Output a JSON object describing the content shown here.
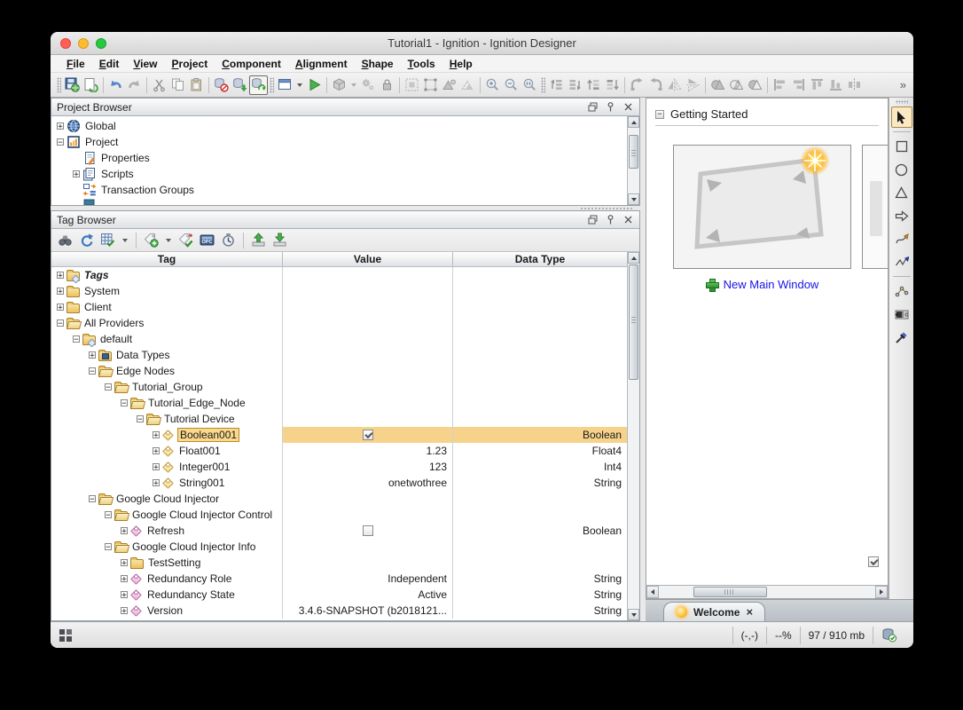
{
  "window": {
    "title": "Tutorial1 - Ignition - Ignition Designer"
  },
  "menu": {
    "items": [
      "File",
      "Edit",
      "View",
      "Project",
      "Component",
      "Alignment",
      "Shape",
      "Tools",
      "Help"
    ]
  },
  "toolbar": {
    "overflow": "»",
    "icons": [
      "save-all",
      "publish",
      "undo",
      "redo",
      "cut",
      "copy",
      "paste",
      "db-rollback",
      "db-sync",
      "db-merge",
      "new-window",
      "preview-play",
      "component-cube",
      "gears",
      "lock",
      "selection-bounds",
      "selection-frame",
      "shape-select",
      "shape-select-alt",
      "zoom-in",
      "zoom-out",
      "zoom-actual",
      "order-forward",
      "order-backward",
      "order-front",
      "order-back",
      "rotate-cw",
      "rotate-ccw",
      "flip-horizontal",
      "flip-vertical",
      "shape-union",
      "shape-intersect",
      "shape-subtract",
      "align-left",
      "align-right",
      "align-top",
      "align-bottom",
      "distribute"
    ]
  },
  "projectBrowser": {
    "title": "Project Browser",
    "items": [
      {
        "exp": "+",
        "label": "Global"
      },
      {
        "exp": "−",
        "label": "Project"
      },
      {
        "exp": "",
        "label": "Properties"
      },
      {
        "exp": "+",
        "label": "Scripts"
      },
      {
        "exp": "",
        "label": "Transaction Groups"
      }
    ]
  },
  "tagBrowser": {
    "title": "Tag Browser",
    "columns": {
      "tag": "Tag",
      "value": "Value",
      "type": "Data Type"
    },
    "opcLabel": "OPC",
    "rows": [
      {
        "exp": "+",
        "label": "Tags",
        "value": "",
        "type": ""
      },
      {
        "exp": "+",
        "label": "System",
        "value": "",
        "type": ""
      },
      {
        "exp": "+",
        "label": "Client",
        "value": "",
        "type": ""
      },
      {
        "exp": "−",
        "label": "All Providers",
        "value": "",
        "type": ""
      },
      {
        "exp": "−",
        "label": "default",
        "value": "",
        "type": ""
      },
      {
        "exp": "+",
        "label": "Data Types",
        "value": "",
        "type": ""
      },
      {
        "exp": "−",
        "label": "Edge Nodes",
        "value": "",
        "type": ""
      },
      {
        "exp": "−",
        "label": "Tutorial_Group",
        "value": "",
        "type": ""
      },
      {
        "exp": "−",
        "label": "Tutorial_Edge_Node",
        "value": "",
        "type": ""
      },
      {
        "exp": "−",
        "label": "Tutorial Device",
        "value": "",
        "type": ""
      },
      {
        "exp": "+",
        "label": "Boolean001",
        "checked": true,
        "type": "Boolean",
        "selected": true
      },
      {
        "exp": "+",
        "label": "Float001",
        "value": "1.23",
        "type": "Float4"
      },
      {
        "exp": "+",
        "label": "Integer001",
        "value": "123",
        "type": "Int4"
      },
      {
        "exp": "+",
        "label": "String001",
        "value": "onetwothree",
        "type": "String"
      },
      {
        "exp": "−",
        "label": "Google Cloud Injector",
        "value": "",
        "type": ""
      },
      {
        "exp": "−",
        "label": "Google Cloud Injector Control",
        "value": "",
        "type": ""
      },
      {
        "exp": "+",
        "label": "Refresh",
        "checked": false,
        "type": "Boolean"
      },
      {
        "exp": "−",
        "label": "Google Cloud Injector Info",
        "value": "",
        "type": ""
      },
      {
        "exp": "+",
        "label": "TestSetting",
        "value": "",
        "type": ""
      },
      {
        "exp": "+",
        "label": "Redundancy Role",
        "value": "Independent",
        "type": "String"
      },
      {
        "exp": "+",
        "label": "Redundancy State",
        "value": "Active",
        "type": "String"
      },
      {
        "exp": "+",
        "label": "Version",
        "value": "3.4.6-SNAPSHOT (b2018121...",
        "type": "String"
      }
    ]
  },
  "gettingStarted": {
    "title": "Getting Started",
    "collapse": "−",
    "newWindowLink": "New Main Window",
    "checkboxChecked": true
  },
  "welcomeTab": {
    "label": "Welcome",
    "close": "×"
  },
  "statusBar": {
    "coords": "(-,-)",
    "zoom": "--%",
    "memory": "97 / 910 mb"
  },
  "colors": {
    "selection": "#F6D28B",
    "selectionBorder": "#BB8A28",
    "linkBlue": "#1414E6",
    "playGreen": "#4CB04C"
  }
}
